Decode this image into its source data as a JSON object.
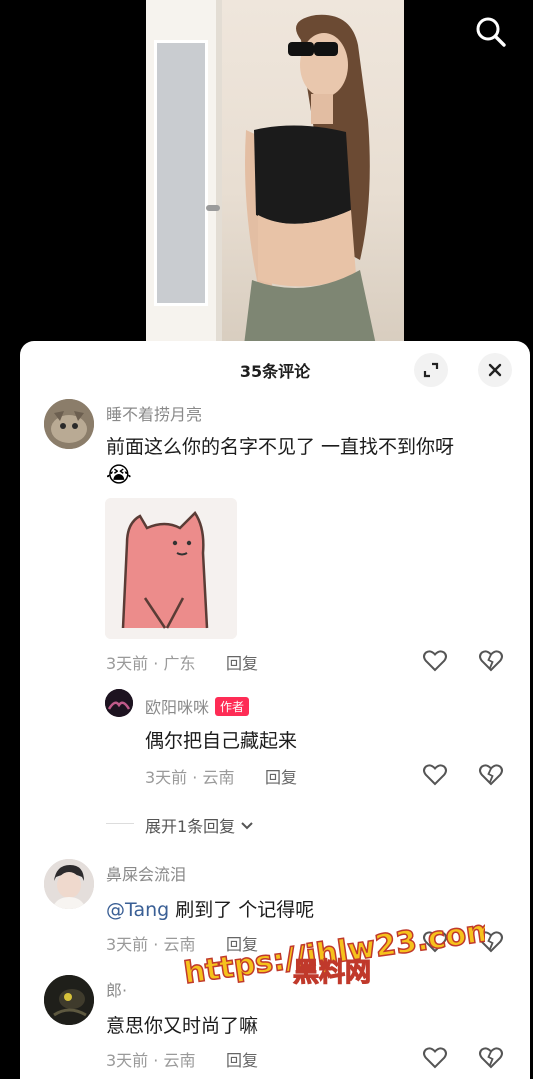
{
  "header": {
    "search_icon": "search-icon"
  },
  "comments_panel": {
    "title": "35条评论",
    "expand_icon": "expand-icon",
    "close_icon": "close-icon"
  },
  "comments": [
    {
      "username": "睡不着捞月亮",
      "text": "前面这么你的名字不见了 一直找不到你呀",
      "emoji": "😭",
      "time": "3天前 · 广东",
      "reply": "回复",
      "replies": [
        {
          "username": "欧阳咪咪",
          "badge": "作者",
          "text": "偶尔把自己藏起来",
          "time": "3天前 · 云南",
          "reply": "回复"
        }
      ],
      "expand_replies": "展开1条回复"
    },
    {
      "username": "鼻屎会流泪",
      "mention": "@Tang",
      "text": " 刷到了 个记得呢",
      "time": "3天前 · 云南",
      "reply": "回复"
    },
    {
      "username": "郎·",
      "text": "意思你又时尚了嘛",
      "time": "3天前 · 云南",
      "reply": "回复"
    }
  ],
  "watermark": {
    "line1": "https://ihlw23.com",
    "line2": "黑料网"
  },
  "colors": {
    "accent": "#fe2c55",
    "mention": "#3a5f95",
    "watermark_fill": "#f6c21c",
    "watermark_stroke": "#c0392b"
  }
}
